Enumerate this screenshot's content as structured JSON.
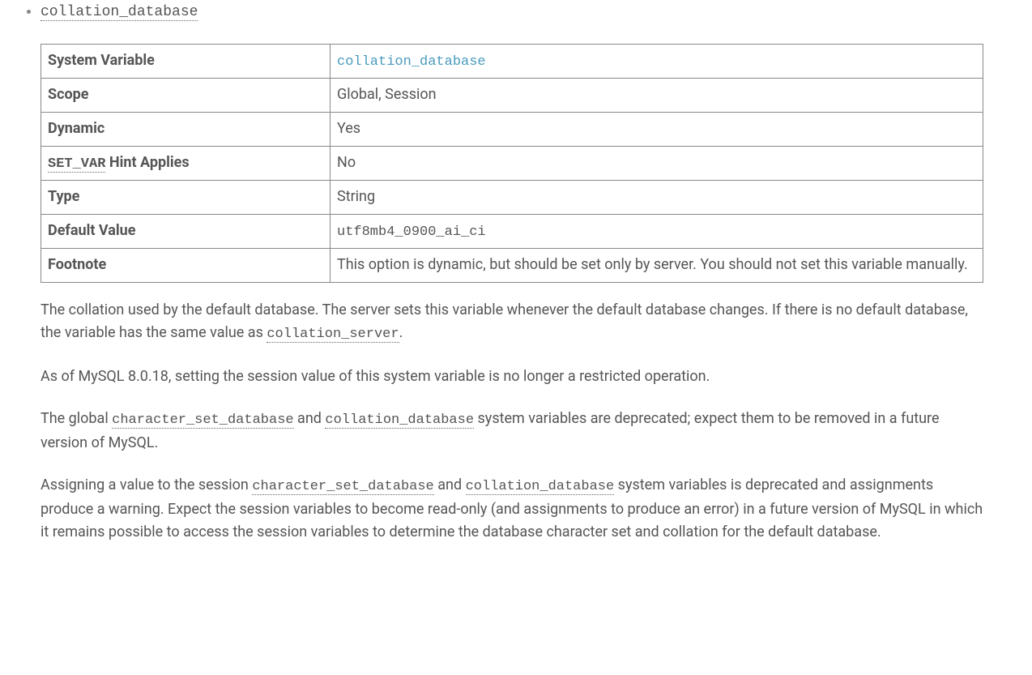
{
  "variable": {
    "name": "collation_database"
  },
  "table": {
    "rows": [
      {
        "label": "System Variable",
        "value": "collation_database",
        "value_mono": true,
        "value_link": true
      },
      {
        "label": "Scope",
        "value": "Global, Session"
      },
      {
        "label": "Dynamic",
        "value": "Yes"
      },
      {
        "label_prefix_mono": "SET_VAR",
        "label_suffix": " Hint Applies",
        "value": "No"
      },
      {
        "label": "Type",
        "value": "String"
      },
      {
        "label": "Default Value",
        "value": "utf8mb4_0900_ai_ci",
        "value_mono": true
      },
      {
        "label": "Footnote",
        "value": "This option is dynamic, but should be set only by server. You should not set this variable manually."
      }
    ]
  },
  "paragraphs": {
    "p1_a": "The collation used by the default database. The server sets this variable whenever the default database changes. If there is no default database, the variable has the same value as ",
    "p1_code": "collation_server",
    "p1_b": ".",
    "p2": "As of MySQL 8.0.18, setting the session value of this system variable is no longer a restricted operation.",
    "p3_a": "The global ",
    "p3_code1": "character_set_database",
    "p3_b": " and ",
    "p3_code2": "collation_database",
    "p3_c": " system variables are deprecated; expect them to be removed in a future version of MySQL.",
    "p4_a": "Assigning a value to the session ",
    "p4_code1": "character_set_database",
    "p4_b": " and ",
    "p4_code2": "collation_database",
    "p4_c": " system variables is deprecated and assignments produce a warning. Expect the session variables to become read-only (and assignments to produce an error) in a future version of MySQL in which it remains possible to access the session variables to determine the database character set and collation for the default database."
  }
}
